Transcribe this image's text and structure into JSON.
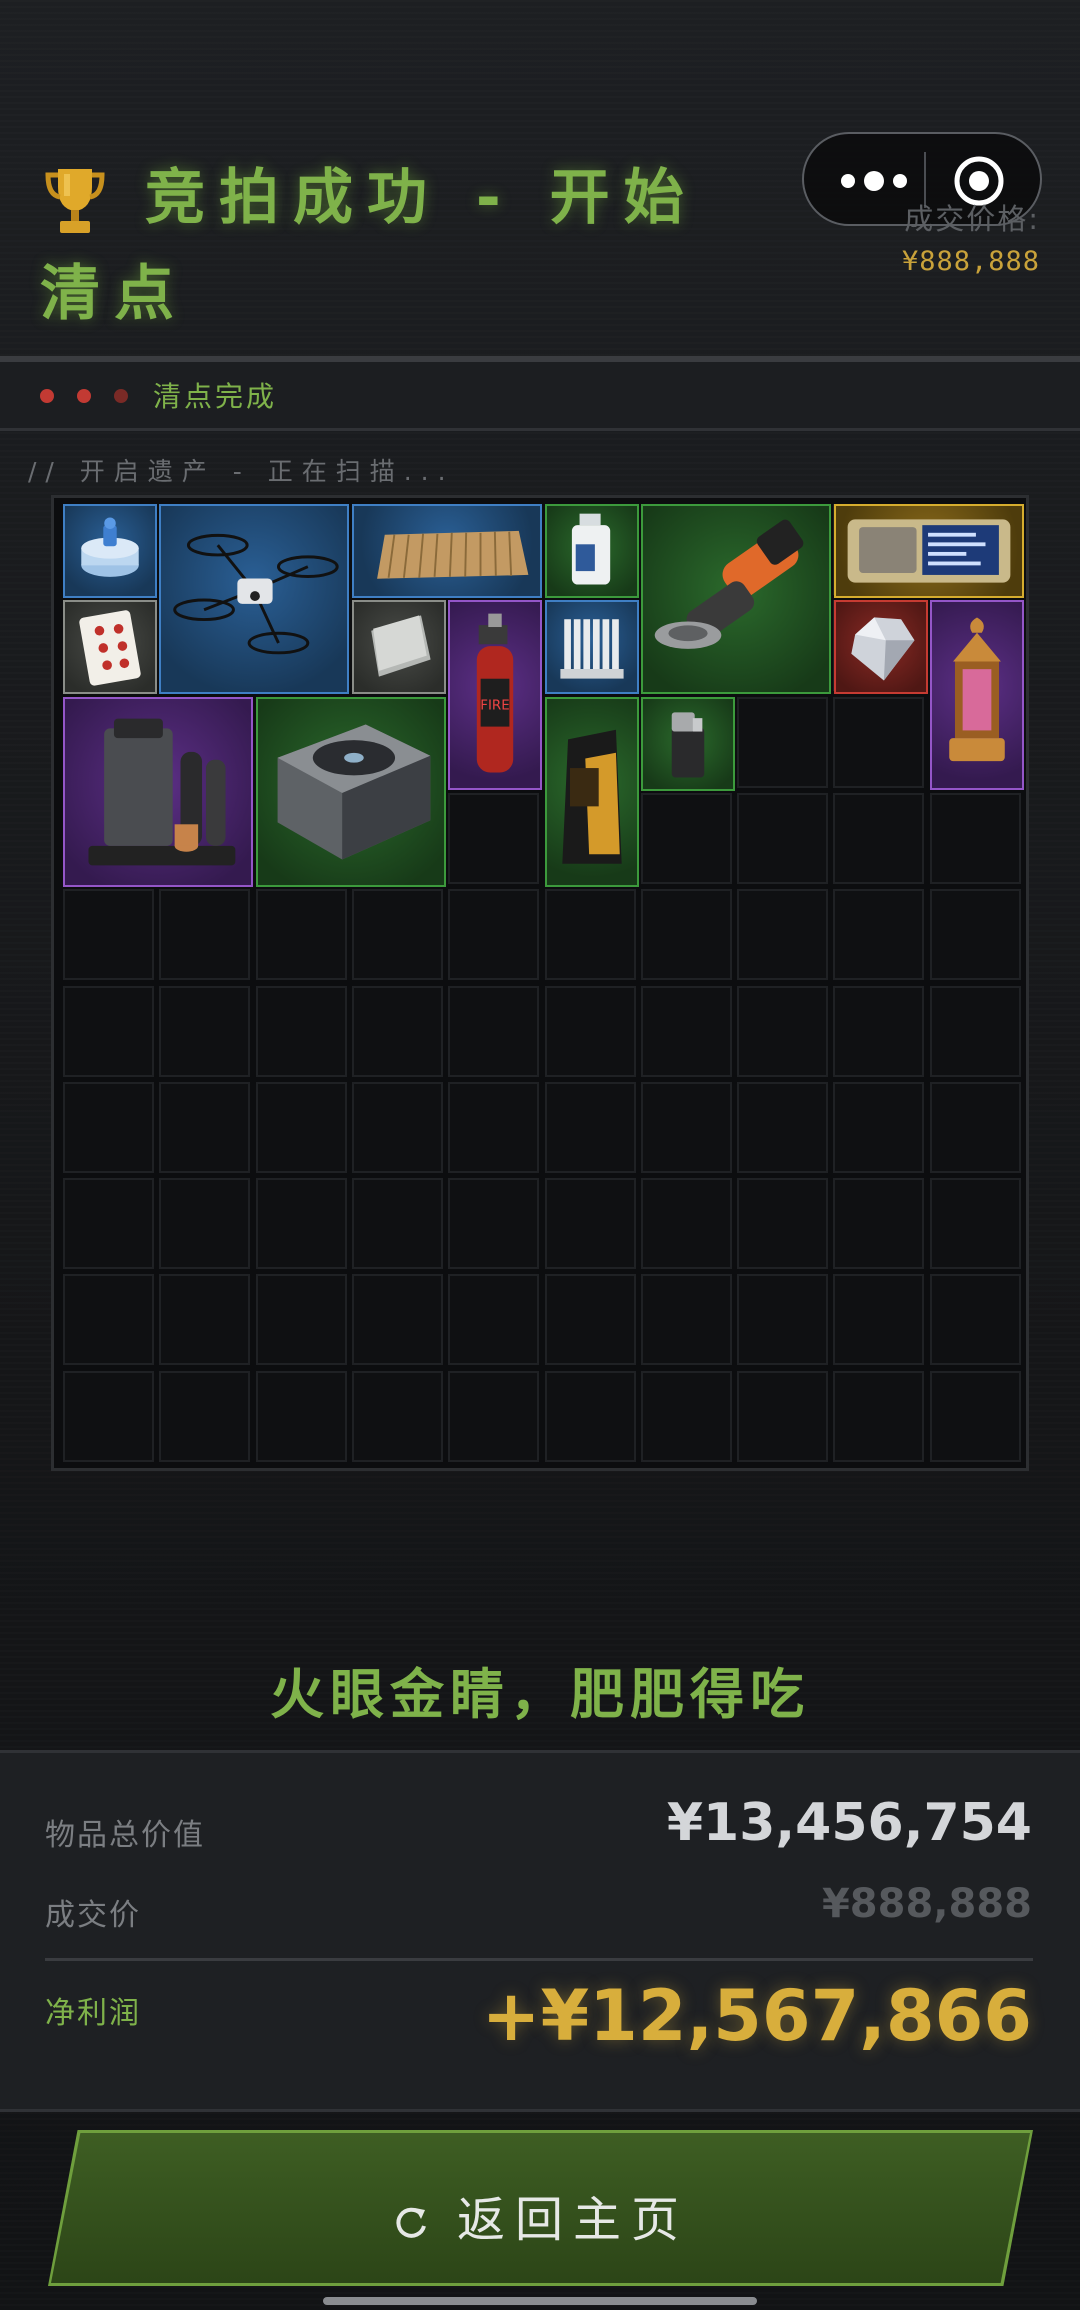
{
  "header": {
    "title": "竞拍成功 - 开始清点",
    "deal_label": "成交价格:",
    "deal_value": "¥888,888"
  },
  "status": {
    "text": "清点完成",
    "led_colors": [
      "#c23a33",
      "#c23a33",
      "#7a2a26"
    ]
  },
  "scan": {
    "text": "// 开启遗产 - 正在扫描..."
  },
  "grid": {
    "cols": 10,
    "rows": 10,
    "items": [
      {
        "name": "fuel-tablet-item",
        "rarity": "blue"
      },
      {
        "name": "drone-item",
        "rarity": "blue"
      },
      {
        "name": "corrugated-board-item",
        "rarity": "blue"
      },
      {
        "name": "bottle-item",
        "rarity": "green"
      },
      {
        "name": "angle-grinder-item",
        "rarity": "green"
      },
      {
        "name": "tablet-device-item",
        "rarity": "gold"
      },
      {
        "name": "playing-card-item",
        "rarity": "gray"
      },
      {
        "name": "paper-stack-item",
        "rarity": "gray"
      },
      {
        "name": "blowtorch-item",
        "rarity": "purple"
      },
      {
        "name": "filter-cartridge-item",
        "rarity": "blue"
      },
      {
        "name": "diamond-item",
        "rarity": "red"
      },
      {
        "name": "lantern-item",
        "rarity": "purple"
      },
      {
        "name": "coffee-machine-item",
        "rarity": "purple"
      },
      {
        "name": "power-supply-item",
        "rarity": "green"
      },
      {
        "name": "coffee-bag-item",
        "rarity": "green"
      },
      {
        "name": "lighter-item",
        "rarity": "green"
      }
    ]
  },
  "quote": "火眼金睛，肥肥得吃",
  "summary": {
    "total_label": "物品总价值",
    "total_value": "¥13,456,754",
    "deal_label": "成交价",
    "deal_value": "¥888,888",
    "profit_label": "净利润",
    "profit_value": "+¥12,567,866"
  },
  "button": {
    "label": "返回主页",
    "icon": "refresh-icon"
  },
  "colors": {
    "accent_green": "#7fb24a",
    "gold": "#d8ae3c",
    "background": "#16171a"
  }
}
